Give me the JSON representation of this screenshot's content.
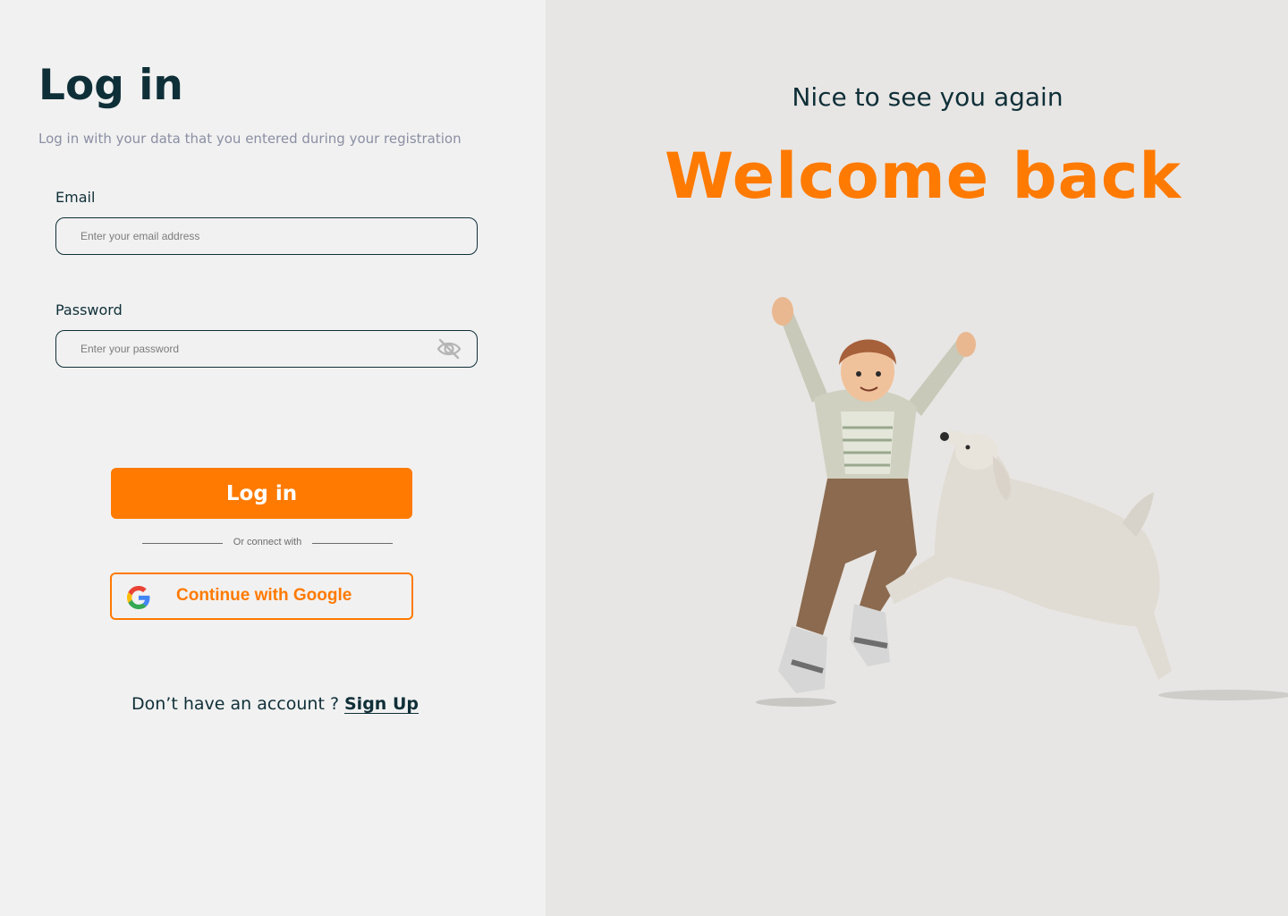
{
  "login": {
    "title": "Log in",
    "subtitle": "Log in with your data that you entered during your registration",
    "email": {
      "label": "Email",
      "placeholder": "Enter your email address",
      "value": ""
    },
    "password": {
      "label": "Password",
      "placeholder": "Enter your password",
      "value": "",
      "toggle_icon": "eye-off-icon"
    },
    "submit_label": "Log in",
    "divider_text": "Or connect with",
    "google_label": "Continue with Google",
    "google_icon": "google-logo-icon",
    "signup_prompt": "Don’t have an account ?",
    "signup_link": "Sign Up"
  },
  "hero": {
    "greeting": "Nice to see you again",
    "title": "Welcome back",
    "illustration": "boy-jumping-with-dog-illustration"
  },
  "colors": {
    "accent": "#ff7a00",
    "text_dark": "#0f2f38",
    "subtitle": "#8a8fa3",
    "left_bg": "#f1f1f1",
    "right_bg": "#e8e6e4"
  }
}
